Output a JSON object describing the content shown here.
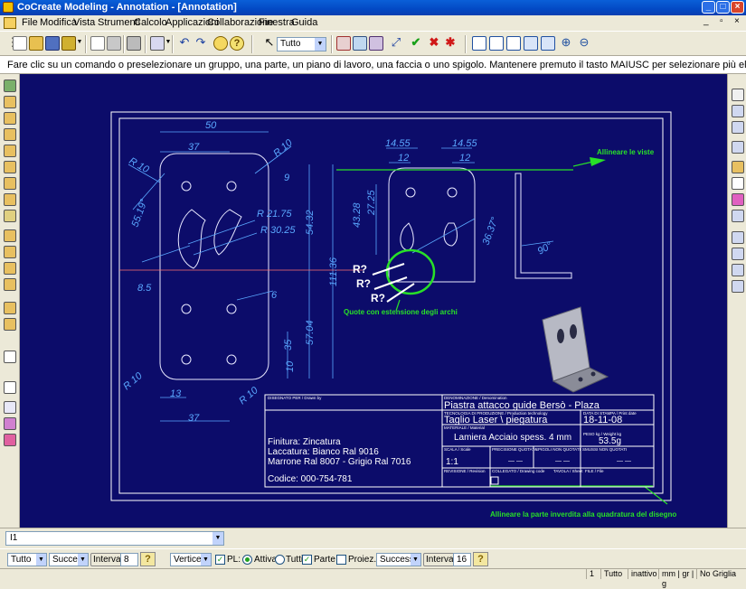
{
  "window": {
    "title": "CoCreate Modeling - Annotation - [Annotation]"
  },
  "menu": [
    "File",
    "Modifica",
    "Vista",
    "Strumenti",
    "Calcolo",
    "Applicazioni",
    "Collaborazione",
    "Finestra",
    "Guida"
  ],
  "toolbar": {
    "filter_value": "Tutto"
  },
  "prompt": "Fare clic su un comando o preselezionare un gruppo, una parte, un piano di lavoro, una faccia o uno spigolo. Mantenere premuto il tasto MAIUSC per selezionare più elementi contemporaneamente",
  "drawing": {
    "annotations": {
      "align_views": "Allineare le viste",
      "arc_extension": "Quote con estensione degli archi",
      "align_part": "Allineare la parte inverdita alla quadratura del disegno"
    },
    "r_labels": [
      "R?",
      "R?",
      "R?"
    ],
    "dims_left": [
      "50",
      "37",
      "13",
      "37",
      "R 10",
      "R 10",
      "R 10",
      "R 10",
      "R 21.75",
      "R 30.25",
      "9",
      "54.32",
      "111.36",
      "57.04",
      "35",
      "10",
      "6",
      "8.5",
      "55.19°"
    ],
    "dims_right": [
      "14.55",
      "14.55",
      "12",
      "12",
      "43.28",
      "27.25",
      "36.37°",
      "90°"
    ],
    "title_block": {
      "designer_label": "DISEGNATO PER / Drawn by",
      "denomination_label": "DENOMINAZIONE / Denomination",
      "denomination": "Piastra attacco guide Bersò - Plaza",
      "technology_label": "TECNOLOGIA DI PRODUZIONE / Production technology",
      "technology": "Taglio Laser \\ piegatura",
      "date_label": "DATA DI STAMPA / Print date",
      "date": "18-11-08",
      "material_label": "MATERIALE / Material",
      "material": "Lamiera Acciaio spess. 4 mm",
      "weight_label": "PESO kg / Weight kg",
      "weight": "53.5g",
      "scale_label": "SCALA / Scale",
      "scale": "1:1",
      "finish": "Finitura:   Zincatura",
      "paint1": "Laccatura:        Bianco Ral 9016",
      "paint2": "Marrone Ral 8007 - Grigio Ral 7016",
      "code": "Codice:  000-754-781",
      "revision_label": "REVISIONE / Revision",
      "drawing_code_label": "COLLEGATO / Drawing code",
      "sheet_label": "TAVOLA / Sheet",
      "file_label": "FILE / File",
      "general_tol_label": "PRECISIONE QUOTATA",
      "angular_tol_label": "SPIGOLI NON QUOTATI",
      "unspec_tol_label": "SMUSSI NON QUOTATI",
      "dash": "— —"
    }
  },
  "command_line": {
    "value": "I1"
  },
  "options": {
    "sel1": "Tutto",
    "sel2": "Successiv",
    "interval_label": "Intervallo",
    "interval_value": "8",
    "sel3": "Vertice",
    "pl_label": "PL:",
    "attiva": "Attiva",
    "tutti": "Tutti",
    "parte": "Parte",
    "proiez": "Proiez.",
    "sel4": "Successiva",
    "interval2_label": "Intervallo",
    "interval2_value": "16"
  },
  "status": {
    "page": "1",
    "filter": "Tutto",
    "state": "inattivo",
    "units": "mm | gr | g",
    "grid": "No Griglia"
  }
}
